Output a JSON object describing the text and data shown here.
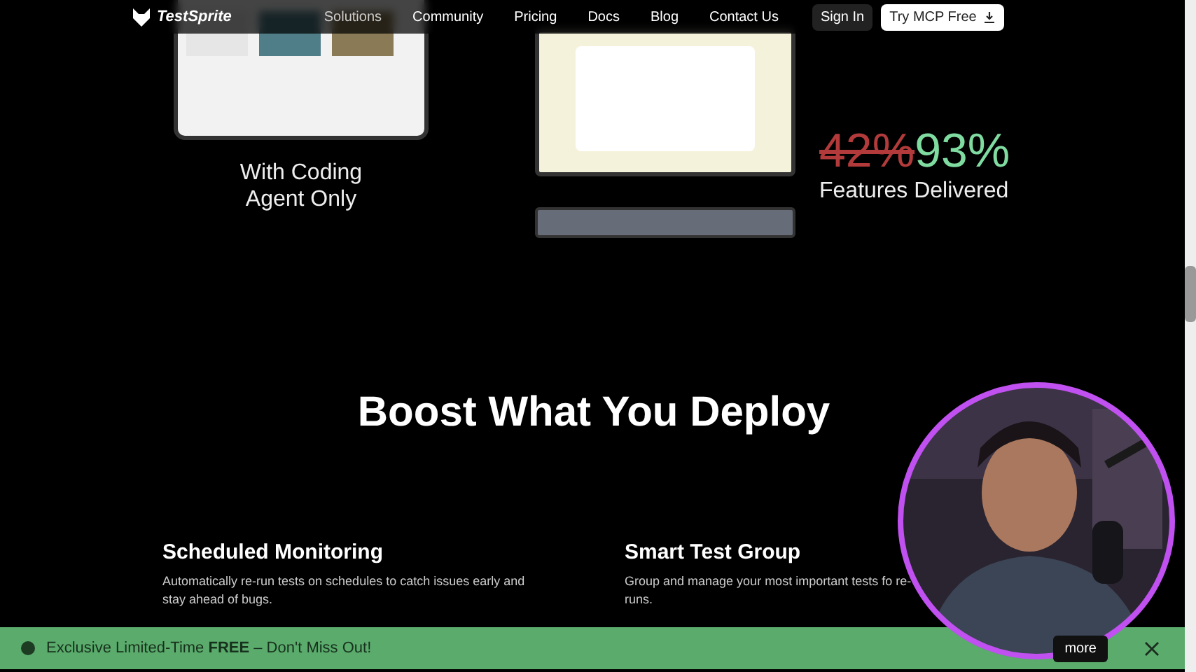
{
  "nav": {
    "logo": "TestSprite",
    "links": [
      "Solutions",
      "Community",
      "Pricing",
      "Docs",
      "Blog",
      "Contact Us"
    ],
    "sign_in": "Sign In",
    "cta": "Try MCP Free"
  },
  "hero": {
    "caption": "With Coding Agent Only",
    "stat_old": "42%",
    "stat_new": "93%",
    "stat_label": "Features Delivered"
  },
  "section": {
    "heading": "Boost What You Deploy",
    "features": [
      {
        "title": "Scheduled Monitoring",
        "description": "Automatically re-run tests on schedules to catch issues early and stay ahead of bugs."
      },
      {
        "title": "Smart Test Group",
        "description": "Group and manage your most important tests fo re-runs."
      }
    ]
  },
  "banner": {
    "text": "Exclusive Limited-Time **FREE** – Don't Miss Out!",
    "button": "more"
  }
}
